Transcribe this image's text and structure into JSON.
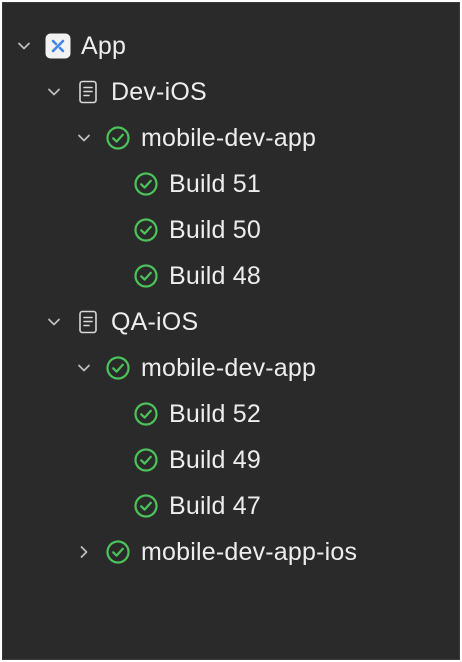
{
  "colors": {
    "panel_bg": "#2a2a2b",
    "text": "#ededed",
    "chevron": "#bdbdbd",
    "success_green": "#4cc35a",
    "app_icon_bg": "#f2f2f2",
    "app_icon_glyph": "#3d86e8"
  },
  "tree": {
    "app": {
      "label": "App",
      "icon": "app-logo-icon",
      "expanded": true
    },
    "groups": [
      {
        "label": "Dev-iOS",
        "icon": "document-icon",
        "expanded": true,
        "pipelines": [
          {
            "label": "mobile-dev-app",
            "icon": "check-circle-icon",
            "expanded": true,
            "builds": [
              {
                "label": "Build 51",
                "icon": "check-circle-icon"
              },
              {
                "label": "Build 50",
                "icon": "check-circle-icon"
              },
              {
                "label": "Build 48",
                "icon": "check-circle-icon"
              }
            ]
          }
        ]
      },
      {
        "label": "QA-iOS",
        "icon": "document-icon",
        "expanded": true,
        "pipelines": [
          {
            "label": "mobile-dev-app",
            "icon": "check-circle-icon",
            "expanded": true,
            "builds": [
              {
                "label": "Build 52",
                "icon": "check-circle-icon"
              },
              {
                "label": "Build 49",
                "icon": "check-circle-icon"
              },
              {
                "label": "Build 47",
                "icon": "check-circle-icon"
              }
            ]
          },
          {
            "label": "mobile-dev-app-ios",
            "icon": "check-circle-icon",
            "expanded": false,
            "builds": []
          }
        ]
      }
    ]
  }
}
